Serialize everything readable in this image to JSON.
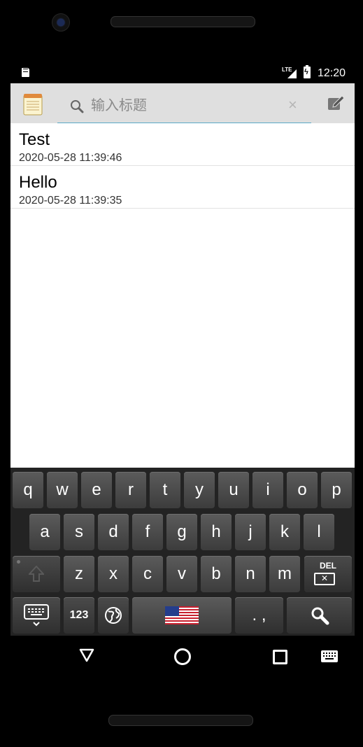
{
  "status_bar": {
    "network": "LTE",
    "time": "12:20"
  },
  "app_bar": {
    "search_placeholder": "输入标题",
    "clear_glyph": "×"
  },
  "notes": [
    {
      "title": "Test",
      "date": "2020-05-28 11:39:46"
    },
    {
      "title": "Hello",
      "date": "2020-05-28 11:39:35"
    }
  ],
  "keyboard": {
    "row1": [
      "q",
      "w",
      "e",
      "r",
      "t",
      "y",
      "u",
      "i",
      "o",
      "p"
    ],
    "row2": [
      "a",
      "s",
      "d",
      "f",
      "g",
      "h",
      "j",
      "k",
      "l"
    ],
    "row3": [
      "z",
      "x",
      "c",
      "v",
      "b",
      "n",
      "m"
    ],
    "delete_label": "DEL",
    "numbers_label": "123",
    "punctuation_label": ". ,"
  },
  "colors": {
    "app_bar_bg": "#dfdfdf",
    "search_underline": "#5ba9c7",
    "key_bg": "#4b4b4b"
  },
  "icons": {
    "app": "notepad-icon",
    "search": "search-icon",
    "clear": "clear-icon",
    "compose": "compose-icon",
    "nav_back": "triangle-back-icon",
    "nav_home": "circle-home-icon",
    "nav_recents": "square-recents-icon",
    "nav_keyboard": "keyboard-icon"
  }
}
